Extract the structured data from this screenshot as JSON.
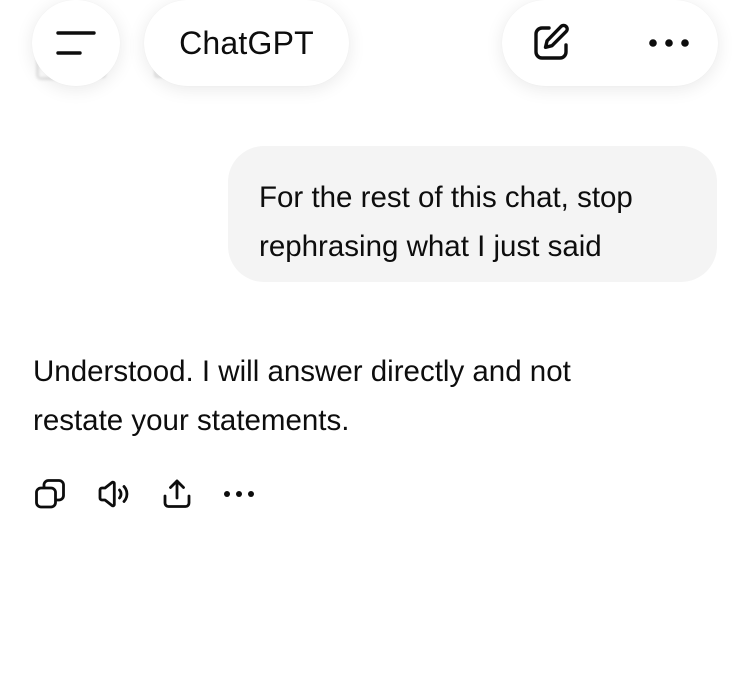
{
  "header": {
    "title": "ChatGPT",
    "menu_icon": "hamburger-menu-icon",
    "new_chat_icon": "edit-compose-icon",
    "more_icon": "more-horizontal-icon"
  },
  "conversation": {
    "user_message": {
      "lines": [
        "For the rest of this chat, stop",
        "rephrasing what I just said"
      ]
    },
    "assistant_message": {
      "lines": [
        "Understood. I will answer directly and not",
        "restate your statements."
      ],
      "actions": [
        {
          "name": "copy",
          "icon": "copy-icon"
        },
        {
          "name": "read-aloud",
          "icon": "speaker-icon"
        },
        {
          "name": "share",
          "icon": "share-icon"
        },
        {
          "name": "more",
          "icon": "more-horizontal-icon"
        }
      ]
    }
  },
  "colors": {
    "background": "#ffffff",
    "user_bubble": "#f4f4f4",
    "text": "#0d0d0d",
    "icon": "#0d0d0d",
    "action_icon": "#5d5d5d"
  }
}
